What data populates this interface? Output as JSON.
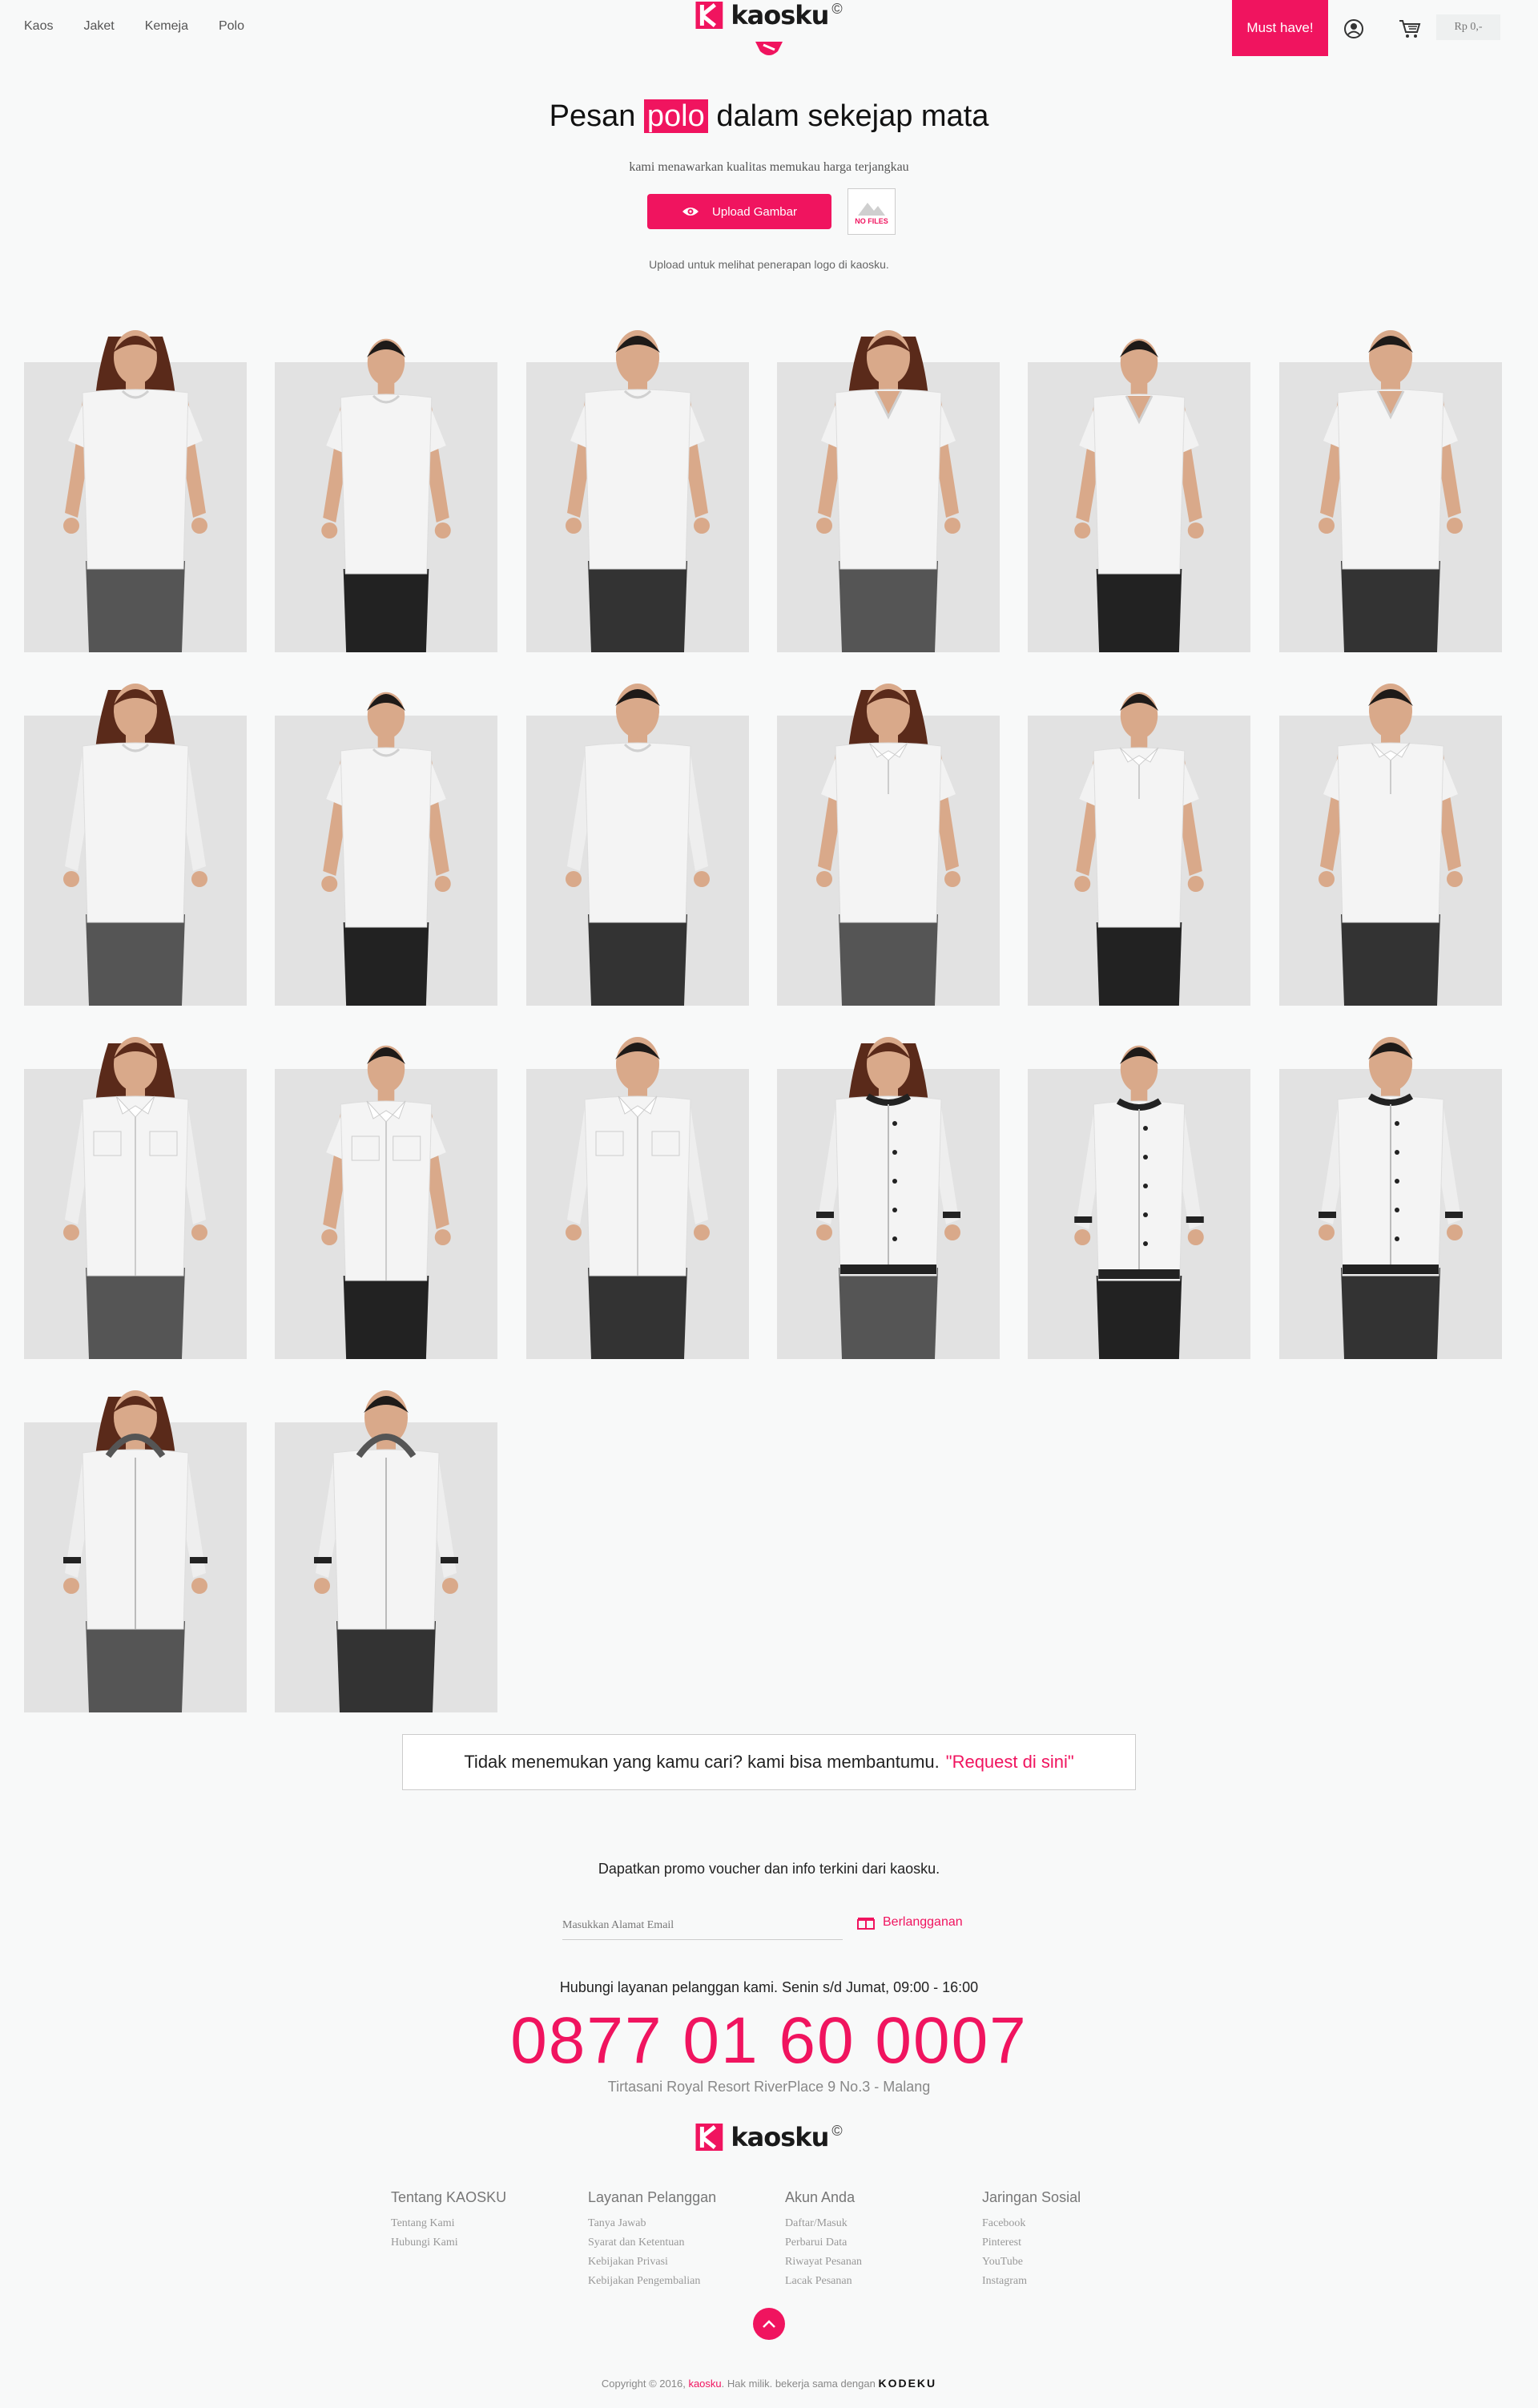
{
  "nav": {
    "items": [
      "Kaos",
      "Jaket",
      "Kemeja",
      "Polo"
    ]
  },
  "brand": {
    "name": "kaosku",
    "copyright_mark": "©",
    "accent": "#f0145f"
  },
  "header": {
    "cta": "Must have!",
    "cart_total": "Rp 0,-",
    "user_icon": "user-circle-icon",
    "cart_icon": "cart-icon"
  },
  "hero": {
    "title_pre": "Pesan",
    "title_highlight": "polo",
    "title_post": "dalam sekejap mata",
    "subtitle": "kami menawarkan kualitas memukau harga terjangkau",
    "upload_label": "Upload Gambar",
    "nofiles_label": "NO FILES",
    "hint": "Upload untuk melihat penerapan logo di kaosku."
  },
  "products": [
    {
      "model": "woman",
      "garment": "tshirt-crew",
      "collar": "#ffffff",
      "bottom": "#555555"
    },
    {
      "model": "boy",
      "garment": "tshirt-crew",
      "collar": "#ffffff",
      "bottom": "#222222"
    },
    {
      "model": "man",
      "garment": "tshirt-crew",
      "collar": "#ffffff",
      "bottom": "#333333"
    },
    {
      "model": "woman",
      "garment": "tshirt-v",
      "collar": "#ffffff",
      "bottom": "#555555"
    },
    {
      "model": "boy",
      "garment": "tshirt-v",
      "collar": "#ffffff",
      "bottom": "#222222"
    },
    {
      "model": "man",
      "garment": "tshirt-v",
      "collar": "#ffffff",
      "bottom": "#333333"
    },
    {
      "model": "woman",
      "garment": "longsleeve",
      "collar": "#ffffff",
      "bottom": "#555555"
    },
    {
      "model": "boy",
      "garment": "tshirt-crew",
      "collar": "#ffffff",
      "bottom": "#222222"
    },
    {
      "model": "man",
      "garment": "longsleeve",
      "collar": "#ffffff",
      "bottom": "#333333"
    },
    {
      "model": "woman",
      "garment": "polo",
      "collar": "#ffffff",
      "bottom": "#555555"
    },
    {
      "model": "boy",
      "garment": "polo",
      "collar": "#ffffff",
      "bottom": "#222222"
    },
    {
      "model": "man",
      "garment": "polo",
      "collar": "#ffffff",
      "bottom": "#333333"
    },
    {
      "model": "woman",
      "garment": "shirt",
      "collar": "#ffffff",
      "bottom": "#555555"
    },
    {
      "model": "boy",
      "garment": "shirt-short",
      "collar": "#ffffff",
      "bottom": "#222222"
    },
    {
      "model": "man",
      "garment": "shirt",
      "collar": "#ffffff",
      "bottom": "#333333"
    },
    {
      "model": "woman",
      "garment": "varsity",
      "collar": "#222222",
      "bottom": "#555555"
    },
    {
      "model": "boy",
      "garment": "varsity",
      "collar": "#222222",
      "bottom": "#222222"
    },
    {
      "model": "man",
      "garment": "varsity",
      "collar": "#222222",
      "bottom": "#333333"
    },
    {
      "model": "woman",
      "garment": "hoodie",
      "collar": "#222222",
      "bottom": "#555555"
    },
    {
      "model": "man",
      "garment": "hoodie",
      "collar": "#222222",
      "bottom": "#333333"
    }
  ],
  "request": {
    "text": "Tidak menemukan yang kamu cari? kami bisa membantumu.",
    "link": "\"Request di sini\""
  },
  "newsletter": {
    "title": "Dapatkan promo voucher dan info terkini dari kaosku.",
    "placeholder": "Masukkan Alamat Email",
    "button": "Berlangganan"
  },
  "contact": {
    "text": "Hubungi layanan pelanggan kami. Senin s/d Jumat, 09:00 - 16:00",
    "phone": "0877 01 60 0007",
    "address": "Tirtasani Royal Resort RiverPlace 9 No.3 - Malang"
  },
  "footer": {
    "columns": [
      {
        "title": "Tentang KAOSKU",
        "links": [
          "Tentang Kami",
          "Hubungi Kami"
        ]
      },
      {
        "title": "Layanan Pelanggan",
        "links": [
          "Tanya Jawab",
          "Syarat dan Ketentuan",
          "Kebijakan Privasi",
          "Kebijakan Pengembalian"
        ]
      },
      {
        "title": "Akun Anda",
        "links": [
          "Daftar/Masuk",
          "Perbarui Data",
          "Riwayat Pesanan",
          "Lacak Pesanan"
        ]
      },
      {
        "title": "Jaringan Sosial",
        "links": [
          "Facebook",
          "Pinterest",
          "YouTube",
          "Instagram"
        ]
      }
    ],
    "copyright_pre": "Copyright © 2016,",
    "copyright_brand": "kaosku",
    "copyright_post": ". Hak milik. bekerja sama dengan",
    "partner": "KODEKU"
  }
}
